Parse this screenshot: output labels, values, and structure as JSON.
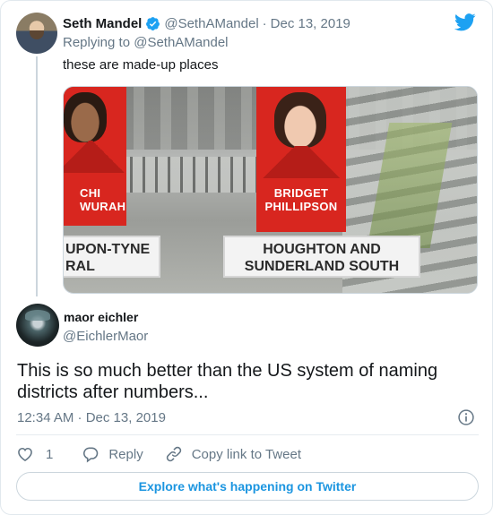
{
  "colors": {
    "accent": "#1b95e0",
    "text_primary": "#14171a",
    "text_secondary": "#657786",
    "border": "#e1e8ed",
    "verified_badge": "#1da1f2",
    "banner_red": "#d8261f"
  },
  "parent_tweet": {
    "author_name": "Seth Mandel",
    "author_handle": "@SethAMandel",
    "separator": "·",
    "date": "Dec 13, 2019",
    "replying_to": "Replying to @SethAMandel",
    "text": "these are made-up places",
    "avatar_icon": "avatar-photo",
    "verified_icon": "verified-badge-icon",
    "logo_icon": "twitter-bird-icon",
    "media": {
      "banners": [
        {
          "name_line1": "CHI",
          "name_line2": "WURAH"
        },
        {
          "name_line1": "BRIDGET",
          "name_line2": "PHILLIPSON"
        }
      ],
      "signs": [
        {
          "line1": "UPON-TYNE",
          "line2": "RAL"
        },
        {
          "line1": "HOUGHTON AND",
          "line2": "SUNDERLAND SOUTH"
        }
      ]
    }
  },
  "reply_tweet": {
    "author_name": "maor eichler",
    "author_handle": "@EichlerMaor",
    "text": "This is so much better than the US system of naming districts after numbers...",
    "timestamp": "12:34 AM · Dec 13, 2019",
    "avatar_icon": "avatar-photo",
    "info_icon": "info-icon"
  },
  "actions": {
    "like_count": "1",
    "reply_label": "Reply",
    "copy_link_label": "Copy link to Tweet",
    "like_icon": "heart-icon",
    "reply_icon": "comment-bubble-icon",
    "copy_link_icon": "link-icon"
  },
  "explore_label": "Explore what's happening on Twitter"
}
